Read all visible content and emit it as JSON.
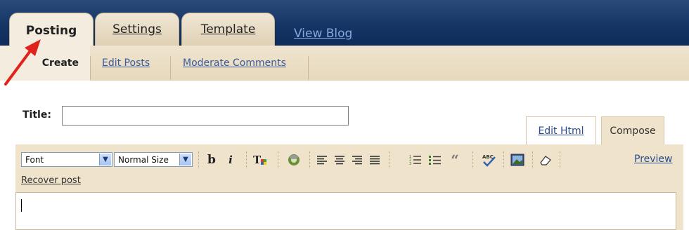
{
  "nav": {
    "tabs": [
      {
        "label": "Posting"
      },
      {
        "label": "Settings"
      },
      {
        "label": "Template"
      }
    ],
    "view_blog": "View Blog"
  },
  "subnav": {
    "items": [
      {
        "label": "Create"
      },
      {
        "label": "Edit Posts"
      },
      {
        "label": "Moderate Comments"
      }
    ]
  },
  "editor": {
    "title_label": "Title:",
    "title_value": "",
    "mode_tabs": [
      {
        "label": "Edit Html"
      },
      {
        "label": "Compose"
      }
    ],
    "font_select": "Font",
    "size_select": "Normal Size",
    "preview": "Preview",
    "recover": "Recover post"
  },
  "colors": {
    "nav_bar": "#153566",
    "tab_bg": "#e0d1b4",
    "toolbar_bg": "#efe3cb",
    "link": "#3b5a9a",
    "arrow": "#e0241c"
  }
}
